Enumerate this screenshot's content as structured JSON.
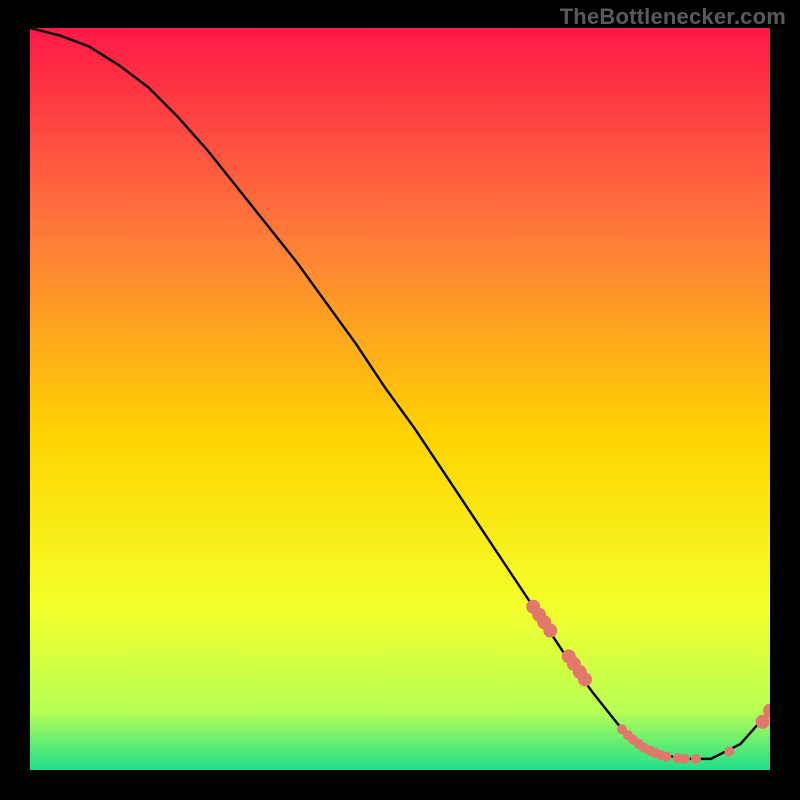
{
  "watermark": "TheBottlenecker.com",
  "chart_data": {
    "type": "line",
    "title": "",
    "xlabel": "",
    "ylabel": "",
    "xlim": [
      0,
      100
    ],
    "ylim": [
      0,
      100
    ],
    "background_gradient": {
      "top": "#ff1846",
      "upper_mid": "#ff7b3a",
      "mid": "#ffd400",
      "lower_mid": "#f4ff2a",
      "near_bottom": "#b8ff55",
      "bottom": "#1fdf8a"
    },
    "series": [
      {
        "name": "bottleneck-curve",
        "x": [
          0,
          4,
          8,
          12,
          16,
          20,
          24,
          28,
          32,
          36,
          40,
          44,
          48,
          52,
          56,
          60,
          64,
          68,
          72,
          76,
          80,
          84,
          88,
          92,
          96,
          100
        ],
        "y": [
          100,
          99,
          97.5,
          95,
          92,
          88,
          83.5,
          78.5,
          73.5,
          68.5,
          63,
          57.5,
          51.5,
          46,
          40,
          34,
          28,
          22,
          16,
          10.5,
          5.5,
          2.5,
          1.5,
          1.5,
          3.5,
          8
        ]
      }
    ],
    "markers": {
      "name": "sample-points",
      "color": "#e2776c",
      "radius_small": 5,
      "radius_large": 7,
      "points": [
        {
          "x": 68.0,
          "y": 22.0,
          "r": 7
        },
        {
          "x": 68.8,
          "y": 20.9,
          "r": 7
        },
        {
          "x": 69.5,
          "y": 19.9,
          "r": 7
        },
        {
          "x": 70.3,
          "y": 18.8,
          "r": 7
        },
        {
          "x": 72.8,
          "y": 15.3,
          "r": 7
        },
        {
          "x": 73.5,
          "y": 14.3,
          "r": 7
        },
        {
          "x": 74.3,
          "y": 13.2,
          "r": 7
        },
        {
          "x": 75.0,
          "y": 12.2,
          "r": 7
        },
        {
          "x": 80.0,
          "y": 5.5,
          "r": 5
        },
        {
          "x": 80.8,
          "y": 4.7,
          "r": 5
        },
        {
          "x": 81.5,
          "y": 4.1,
          "r": 5
        },
        {
          "x": 82.3,
          "y": 3.5,
          "r": 5
        },
        {
          "x": 83.0,
          "y": 3.0,
          "r": 5
        },
        {
          "x": 83.8,
          "y": 2.6,
          "r": 5
        },
        {
          "x": 84.5,
          "y": 2.3,
          "r": 5
        },
        {
          "x": 85.3,
          "y": 2.0,
          "r": 5
        },
        {
          "x": 86.0,
          "y": 1.8,
          "r": 5
        },
        {
          "x": 87.5,
          "y": 1.6,
          "r": 5
        },
        {
          "x": 88.5,
          "y": 1.5,
          "r": 5
        },
        {
          "x": 90.0,
          "y": 1.5,
          "r": 5
        },
        {
          "x": 94.5,
          "y": 2.5,
          "r": 5
        },
        {
          "x": 99.0,
          "y": 6.5,
          "r": 7
        },
        {
          "x": 100.0,
          "y": 8.0,
          "r": 7
        }
      ]
    }
  }
}
